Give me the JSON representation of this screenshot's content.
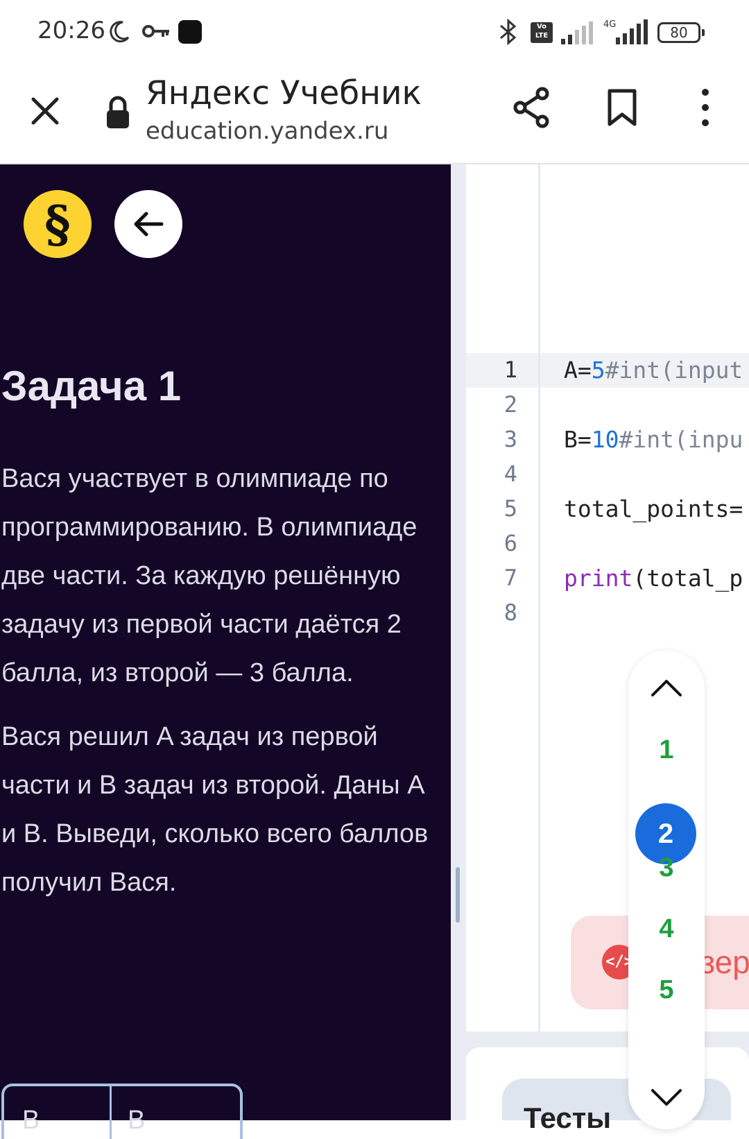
{
  "status_bar": {
    "time": "20:26",
    "battery": "80",
    "network": "4G",
    "volte": "Vo LTE"
  },
  "browser": {
    "title": "Яндекс Учебник",
    "url": "education.yandex.ru"
  },
  "task": {
    "logo_glyph": "§",
    "title": "Задача 1",
    "paragraphs": [
      "Вася участвует в олимпиаде по программированию. В олимпиаде две части. За каждую решённую задачу из первой части даётся 2 балла, из второй — 3 балла.",
      "Вася решил A задач из первой части и B задач из второй. Даны A и B. Выведи, сколько всего баллов получил Вася."
    ],
    "table_headers": [
      "В",
      "В"
    ]
  },
  "editor": {
    "line_numbers": [
      "1",
      "2",
      "3",
      "4",
      "5",
      "6",
      "7",
      "8"
    ],
    "lines": [
      {
        "var": "A=",
        "num": "5",
        "comment": "#int(input"
      },
      {
        "var": "B=",
        "num": "10",
        "comment": "#int(inpu"
      },
      {
        "text": "total_points="
      },
      {
        "kw": "print",
        "rest": "(total_p"
      }
    ]
  },
  "run_button": {
    "icon": "</>",
    "label": "зер"
  },
  "tests": {
    "label": "Тесты"
  },
  "task_nav": {
    "items": [
      "1",
      "2",
      "3",
      "4",
      "5"
    ],
    "active": "2"
  }
}
